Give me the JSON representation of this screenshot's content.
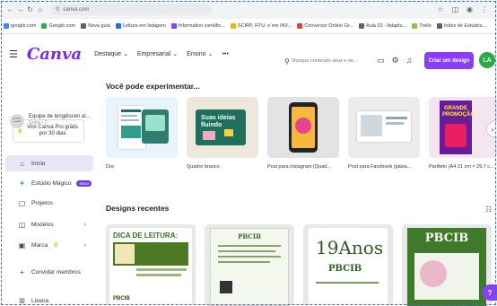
{
  "browser": {
    "url": "canva.com",
    "bookmarks": [
      {
        "label": "google.com",
        "color": "#4285f4"
      },
      {
        "label": "Google.com",
        "color": "#34a853"
      },
      {
        "label": "Nova guia",
        "color": "#5f6368"
      },
      {
        "label": "Leitura em listagem",
        "color": "#1a73e8"
      },
      {
        "label": "Informativo científic...",
        "color": "#8b3dff"
      },
      {
        "label": "SCIRP, RTU, e em INV...",
        "color": "#f4b400"
      },
      {
        "label": "Conversor Online Gr...",
        "color": "#db4437"
      },
      {
        "label": "Aula 03 - Adaptu...",
        "color": "#5f6368"
      },
      {
        "label": "Trello",
        "color": "#8bc34a"
      },
      {
        "label": "Index de Estudos...",
        "color": "#5f6368"
      }
    ]
  },
  "header": {
    "logo": "Canva",
    "nav": [
      "Destaque",
      "Empresarial",
      "Ensino",
      "•••"
    ],
    "search_placeholder": "Busque conteúdo seus e de...",
    "create_button": "Criar um design",
    "avatar_initials": "LA"
  },
  "sidebar": {
    "team_initials": "ED",
    "team_name": "Equipe de lengdiscen al...",
    "team_sub": "Grátis • 2",
    "trial_text": "Vire Canva Pro grátis por 30 dias",
    "items": [
      {
        "label": "Início",
        "icon": "⌂",
        "active": true
      },
      {
        "label": "Estúdio Mágico",
        "icon": "✦",
        "badge": "Novo"
      },
      {
        "label": "Projetos",
        "icon": "▢"
      },
      {
        "label": "Modelos",
        "icon": "◫",
        "chevron": "›"
      },
      {
        "label": "Marca",
        "icon": "▣",
        "crown": true,
        "chevron": "›"
      },
      {
        "label": "Convidar membros",
        "icon": "+"
      },
      {
        "label": "Lixeira",
        "icon": "🗑"
      }
    ]
  },
  "main": {
    "try_title": "Você pode experimentar...",
    "try_cards": [
      {
        "label": "Doc"
      },
      {
        "label": "Quadro branco"
      },
      {
        "label": "Post para Instagram (Quad..."
      },
      {
        "label": "Post para Facebook (paisa..."
      },
      {
        "label": "Panfleto (A4 21 cm × 29,7 c..."
      }
    ],
    "recent_title": "Designs recentes",
    "recent_cards": [
      {
        "title": "DICA DE LEITURA:",
        "footer": "PBCIB"
      },
      {
        "title": "PBCIB"
      },
      {
        "title": "19Anos",
        "sub": "PBCIB"
      },
      {
        "title": "PBCIB"
      }
    ]
  },
  "colors": {
    "brand": "#7d2ae8",
    "create": "#8b3dff",
    "avatar": "#2ba84a",
    "active_item": "#eae6f8"
  }
}
